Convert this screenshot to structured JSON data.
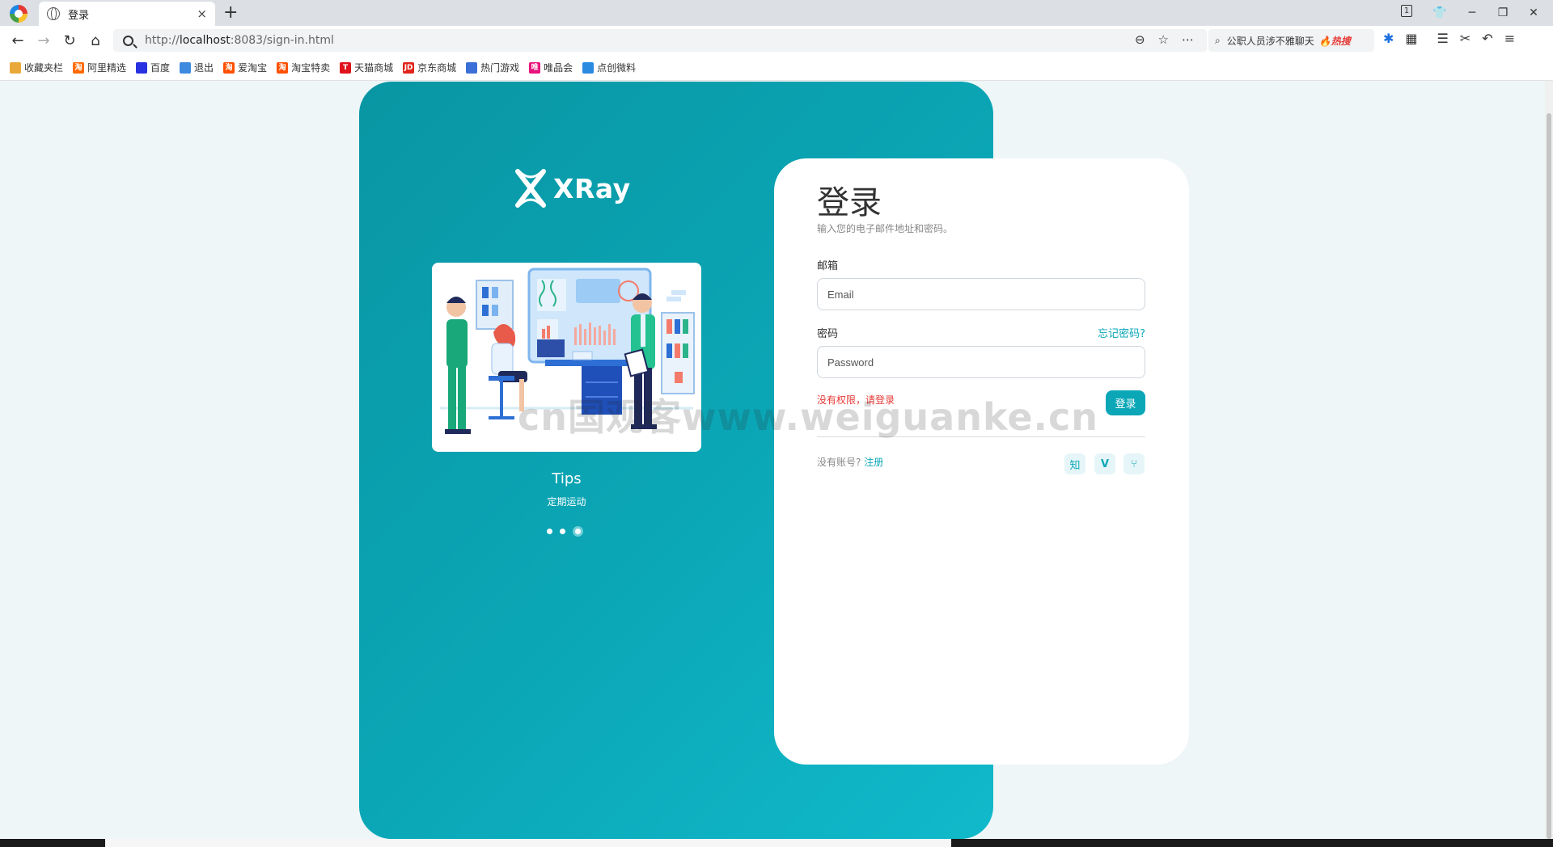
{
  "browser": {
    "tab_title": "登录",
    "tab_close": "×",
    "new_tab": "+",
    "window_badge": "1",
    "url_prefix": "http://",
    "url_host": "localhost",
    "url_rest": ":8083/sign-in.html",
    "hot_search_text": "公职人员涉不雅聊天",
    "hot_search_badge": "🔥热搜"
  },
  "bookmarks": [
    {
      "label": "收藏夹栏",
      "color": "#e8a93a"
    },
    {
      "label": "阿里精选",
      "color": "#ff6a00"
    },
    {
      "label": "百度",
      "color": "#2932e1"
    },
    {
      "label": "退出",
      "color": "#3d8be0"
    },
    {
      "label": "爱淘宝",
      "color": "#ff5000"
    },
    {
      "label": "淘宝特卖",
      "color": "#ff5000"
    },
    {
      "label": "天猫商城",
      "color": "#e0121b"
    },
    {
      "label": "京东商城",
      "color": "#e1251b"
    },
    {
      "label": "热门游戏",
      "color": "#3b6fd8"
    },
    {
      "label": "唯品会",
      "color": "#e8127c"
    },
    {
      "label": "点创微料",
      "color": "#2a8ae0"
    }
  ],
  "bookmark_glyphs": [
    "",
    "淘",
    "",
    "",
    "淘",
    "淘",
    "T",
    "JD",
    "",
    "唯",
    ""
  ],
  "brand": {
    "name": "XRay"
  },
  "carousel": {
    "title": "Tips",
    "subtitle": "定期运动",
    "slide_count": 3,
    "active_index": 3
  },
  "login": {
    "title": "登录",
    "subtitle": "输入您的电子邮件地址和密码。",
    "email_label": "邮箱",
    "email_placeholder": "Email",
    "password_label": "密码",
    "password_placeholder": "Password",
    "forgot_link": "忘记密码?",
    "error_message": "没有权限，请登录",
    "submit_label": "登录",
    "no_account_text": "没有账号?",
    "register_link": "注册",
    "social": [
      "知",
      "V",
      "⑂"
    ]
  },
  "watermark": "cn国观客www.weiguanke.cn",
  "colors": {
    "primary": "#0ba7b7",
    "error": "#e53935",
    "page_bg": "#eef6f8"
  }
}
